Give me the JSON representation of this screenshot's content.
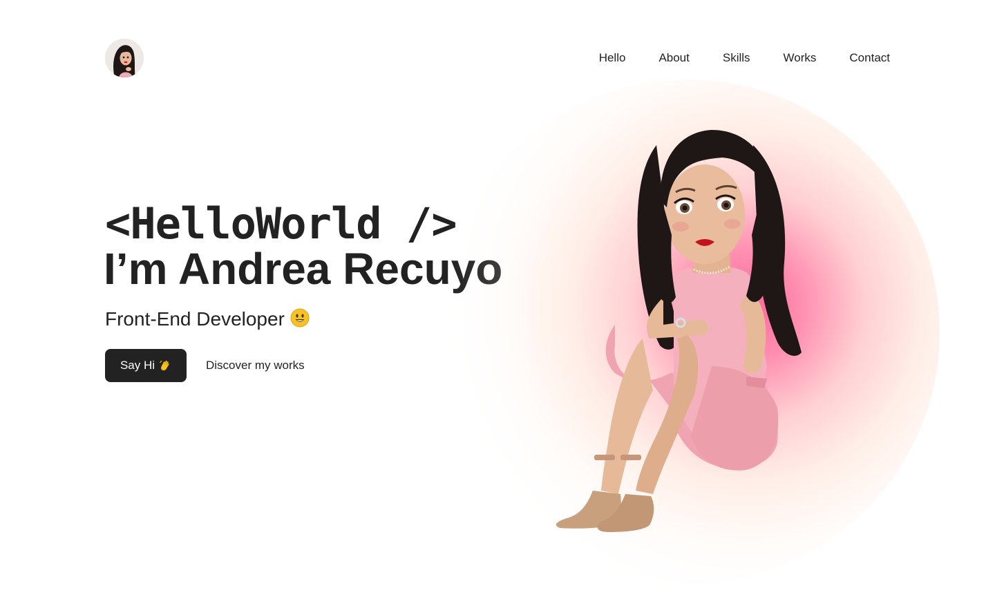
{
  "header": {
    "logo_icon": "avatar-icon",
    "nav": [
      {
        "label": "Hello"
      },
      {
        "label": "About"
      },
      {
        "label": "Skills"
      },
      {
        "label": "Works"
      },
      {
        "label": "Contact"
      }
    ]
  },
  "hero": {
    "code_heading": "<HelloWorld />",
    "name_heading": "I’m Andrea Recuyo",
    "role": "Front-End Developer",
    "role_icon": "smiley-emoji-icon",
    "primary_button": {
      "label": "Say Hi",
      "icon": "waving-hand-icon"
    },
    "secondary_link": {
      "label": "Discover my works"
    },
    "illustration": "avatar-illustration",
    "glow_color": "#ff5c96"
  },
  "colors": {
    "text": "#222222",
    "button_bg": "#222222",
    "button_text": "#ffffff",
    "background": "#ffffff",
    "dress": "#f1a9b5",
    "hair": "#1e1716"
  }
}
